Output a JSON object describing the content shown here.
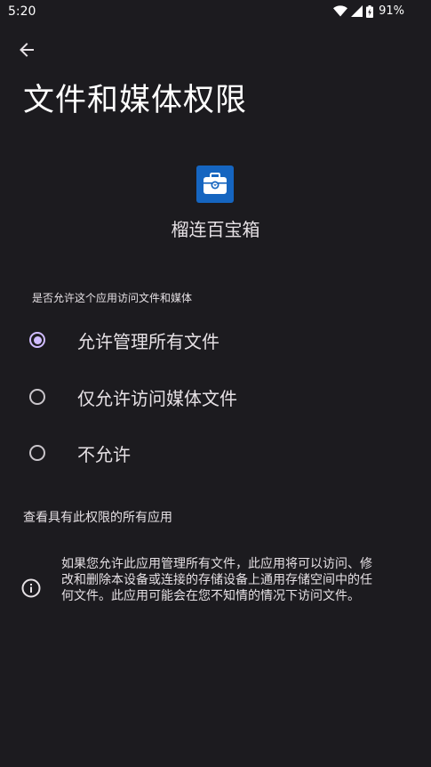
{
  "status_bar": {
    "time": "5:20",
    "battery": "91%",
    "icons": [
      "wifi-icon",
      "signal-icon",
      "battery-icon"
    ]
  },
  "header": {
    "back_icon": "arrow-left-icon",
    "title": "文件和媒体权限"
  },
  "app": {
    "icon": "toolbox-icon",
    "icon_color": "#1565c0",
    "name": "榴连百宝箱"
  },
  "question": "是否允许这个应用访问文件和媒体",
  "options": [
    {
      "label": "允许管理所有文件",
      "selected": true
    },
    {
      "label": "仅允许访问媒体文件",
      "selected": false
    },
    {
      "label": "不允许",
      "selected": false
    }
  ],
  "see_all_link": "查看具有此权限的所有应用",
  "info": {
    "icon": "info-icon",
    "text": "如果您允许此应用管理所有文件，此应用将可以访问、修改和删除本设备或连接的存储设备上通用存储空间中的任何文件。此应用可能会在您不知情的情况下访问文件。"
  },
  "colors": {
    "background": "#1c1b1f",
    "accent": "#d0bcff",
    "text": "#e6e1e5"
  }
}
